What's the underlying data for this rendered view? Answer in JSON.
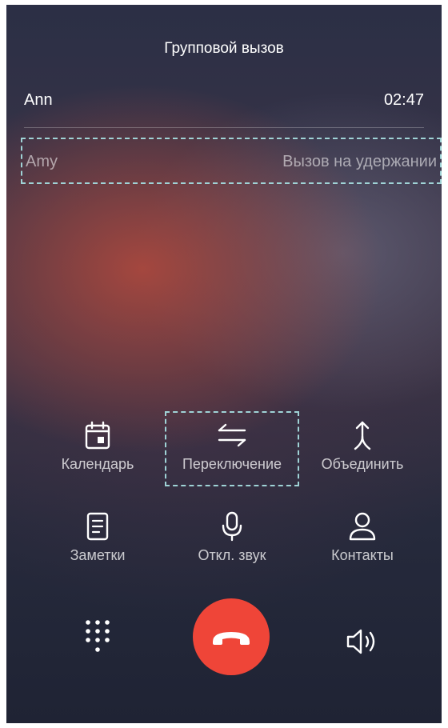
{
  "header": {
    "title": "Групповой вызов"
  },
  "active_call": {
    "name": "Ann",
    "duration": "02:47"
  },
  "held_call": {
    "name": "Amy",
    "status": "Вызов на удержании"
  },
  "actions": {
    "calendar": "Календарь",
    "switch": "Переключение",
    "merge": "Объединить",
    "notes": "Заметки",
    "mute": "Откл. звук",
    "contacts": "Контакты"
  },
  "bottom": {
    "dialpad_icon": "dialpad-icon",
    "end_call_icon": "hang-up-icon",
    "speaker_icon": "speaker-icon",
    "end_call_color": "#ef4538"
  },
  "colors": {
    "highlight_dash": "#9fd3d6"
  }
}
